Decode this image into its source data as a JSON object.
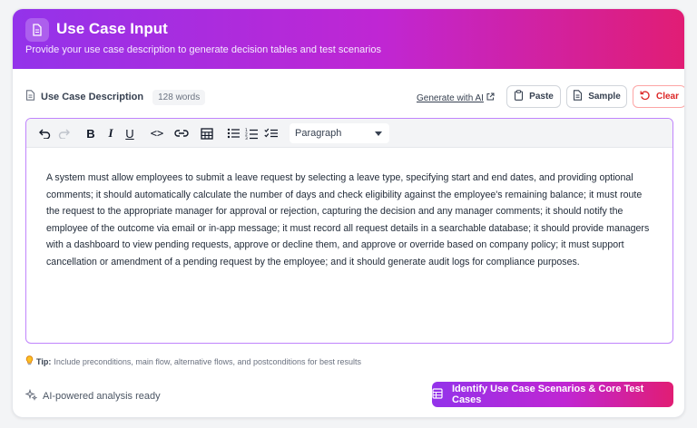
{
  "header": {
    "title": "Use Case Input",
    "subtitle": "Provide your use case description to generate decision tables and test scenarios",
    "icon": "document-icon"
  },
  "section": {
    "label": "Use Case Description",
    "word_count": "128 words",
    "generate_ai": "Generate with AI",
    "paste_label": "Paste",
    "sample_label": "Sample",
    "clear_label": "Clear"
  },
  "toolbar": {
    "bold": "B",
    "italic": "I",
    "underline": "U",
    "code": "<>",
    "paragraph_select": "Paragraph"
  },
  "editor": {
    "content": "A system must allow employees to submit a leave request by selecting a leave type, specifying start and end dates, and providing optional comments; it should automatically calculate the number of days and check eligibility against the employee's remaining balance; it must route the request to the appropriate manager for approval or rejection, capturing the decision and any manager comments; it should notify the employee of the outcome via email or in-app message; it must record all request details in a searchable database; it should provide managers with a dashboard to view pending requests, approve or decline them, and approve or override based on company policy; it must support cancellation or amendment of a pending request by the employee; and it should generate audit logs for compliance purposes."
  },
  "tip": {
    "label": "Tip:",
    "text": "Include preconditions, main flow, alternative flows, and postconditions for best results"
  },
  "footer": {
    "ai_ready": "AI-powered analysis ready",
    "cta_label": "Identify Use Case Scenarios & Core Test Cases"
  },
  "colors": {
    "gradient_start": "#9333ea",
    "gradient_end": "#e11d74",
    "editor_border": "#c084fc",
    "clear_red": "#dc2626"
  }
}
